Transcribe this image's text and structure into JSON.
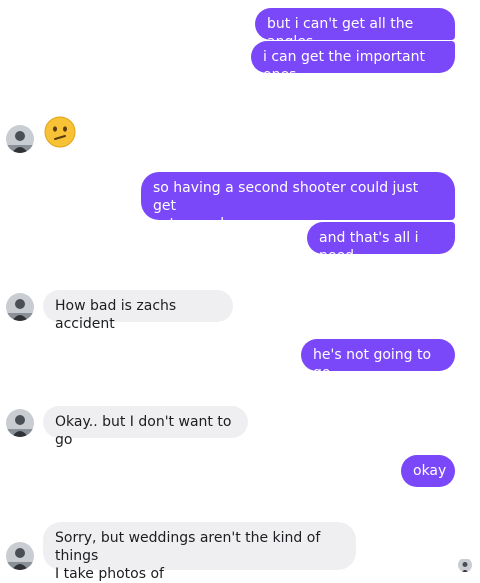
{
  "conversation": {
    "colors": {
      "sent_bubble": "#7b48f9",
      "received_bubble": "#efeff1",
      "received_text": "#1c1e21"
    },
    "messages": [
      {
        "from": "me",
        "text": "but i can't get all the angles"
      },
      {
        "from": "me",
        "text": "i can get the important ones"
      },
      {
        "from": "them",
        "emoji": "confused-face-emoji"
      },
      {
        "from": "me",
        "text": "so having a second shooter could just get\nextra angles"
      },
      {
        "from": "me",
        "text": "and that's all i need"
      },
      {
        "from": "them",
        "text": "How bad is zachs accident"
      },
      {
        "from": "me",
        "text": "he's not going to go"
      },
      {
        "from": "them",
        "text": "Okay.. but I don't want to go"
      },
      {
        "from": "me",
        "text": "okay"
      },
      {
        "from": "them",
        "text": "Sorry, but weddings aren't the kind of things\nI take photos of"
      }
    ],
    "avatar_icon": "contact-avatar-icon",
    "seen_indicator_icon": "seen-avatar-icon"
  }
}
